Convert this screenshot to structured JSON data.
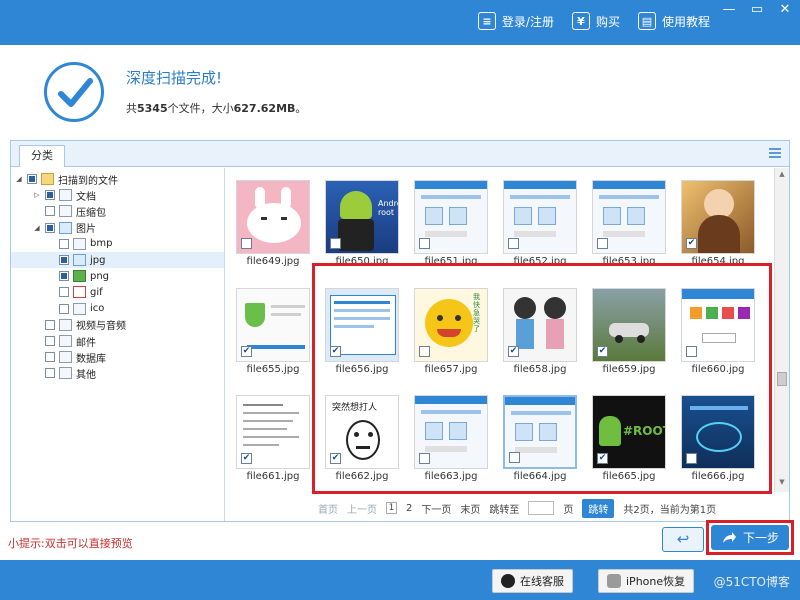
{
  "topbar": {
    "actions": [
      {
        "icon": "user-icon",
        "glyph": "≡",
        "label": "登录/注册"
      },
      {
        "icon": "yen-icon",
        "glyph": "¥",
        "label": "购买"
      },
      {
        "icon": "book-icon",
        "glyph": "▤",
        "label": "使用教程"
      }
    ],
    "window": {
      "minimize": "—",
      "restore": "▭",
      "close": "✕"
    }
  },
  "header": {
    "title": "深度扫描完成!",
    "summary_prefix": "共",
    "file_count": "5345",
    "summary_mid": "个文件，大小",
    "size": "627.62MB",
    "summary_suffix": "。"
  },
  "panel": {
    "tab_label": "分类",
    "tree": [
      {
        "label": "扫描到的文件",
        "level": 0,
        "twisty": "◢",
        "check": "full",
        "icon": "folder"
      },
      {
        "label": "文档",
        "level": 1,
        "twisty": "▷",
        "check": "full",
        "icon": "doc"
      },
      {
        "label": "压缩包",
        "level": 1,
        "twisty": "",
        "check": "empty",
        "icon": "zip"
      },
      {
        "label": "图片",
        "level": 1,
        "twisty": "◢",
        "check": "full",
        "icon": "img"
      },
      {
        "label": "bmp",
        "level": 2,
        "twisty": "",
        "check": "empty",
        "icon": "bmp"
      },
      {
        "label": "jpg",
        "level": 2,
        "twisty": "",
        "check": "full",
        "icon": "img",
        "selected": true
      },
      {
        "label": "png",
        "level": 2,
        "twisty": "",
        "check": "full",
        "icon": "png"
      },
      {
        "label": "gif",
        "level": 2,
        "twisty": "",
        "check": "empty",
        "icon": "gif"
      },
      {
        "label": "ico",
        "level": 2,
        "twisty": "",
        "check": "empty",
        "icon": "ico"
      },
      {
        "label": "视频与音频",
        "level": 1,
        "twisty": "",
        "check": "empty",
        "icon": "video"
      },
      {
        "label": "邮件",
        "level": 1,
        "twisty": "",
        "check": "empty",
        "icon": "mail"
      },
      {
        "label": "数据库",
        "level": 1,
        "twisty": "",
        "check": "empty",
        "icon": "db"
      },
      {
        "label": "其他",
        "level": 1,
        "twisty": "",
        "check": "empty",
        "icon": "other"
      }
    ],
    "files": [
      {
        "name": "file649.jpg",
        "checked": false,
        "art": "bunny"
      },
      {
        "name": "file650.jpg",
        "checked": false,
        "art": "android"
      },
      {
        "name": "file651.jpg",
        "checked": false,
        "art": "screen"
      },
      {
        "name": "file652.jpg",
        "checked": false,
        "art": "screen"
      },
      {
        "name": "file653.jpg",
        "checked": false,
        "art": "screen"
      },
      {
        "name": "file654.jpg",
        "checked": true,
        "art": "photo-warm"
      },
      {
        "name": "file655.jpg",
        "checked": true,
        "art": "shield"
      },
      {
        "name": "file656.jpg",
        "checked": true,
        "art": "screen-blue"
      },
      {
        "name": "file657.jpg",
        "checked": false,
        "art": "smiley"
      },
      {
        "name": "file658.jpg",
        "checked": true,
        "art": "cartoon"
      },
      {
        "name": "file659.jpg",
        "checked": true,
        "art": "car"
      },
      {
        "name": "file660.jpg",
        "checked": false,
        "art": "icons"
      },
      {
        "name": "file661.jpg",
        "checked": true,
        "art": "text-list"
      },
      {
        "name": "file662.jpg",
        "checked": true,
        "art": "meme"
      },
      {
        "name": "file663.jpg",
        "checked": false,
        "art": "screen"
      },
      {
        "name": "file664.jpg",
        "checked": false,
        "art": "screen",
        "selected": true
      },
      {
        "name": "file665.jpg",
        "checked": true,
        "art": "root"
      },
      {
        "name": "file666.jpg",
        "checked": false,
        "art": "blue-graphic"
      }
    ],
    "pager": {
      "first": "首页",
      "prev": "上一页",
      "pages": [
        "1",
        "2"
      ],
      "next": "下一页",
      "last": "末页",
      "jump_to": "跳转至",
      "page_unit": "页",
      "jump_button": "跳转",
      "status": "共2页，当前为第1页"
    }
  },
  "bottom": {
    "tip": "小提示:双击可以直接预览",
    "back_glyph": "↩",
    "next_label": "下一步"
  },
  "footer": {
    "online_service": "在线客服",
    "iphone_recovery": "iPhone恢复",
    "watermark": "@51CTO博客"
  },
  "colors": {
    "primary": "#2f86d5",
    "highlight": "#d9202a"
  }
}
